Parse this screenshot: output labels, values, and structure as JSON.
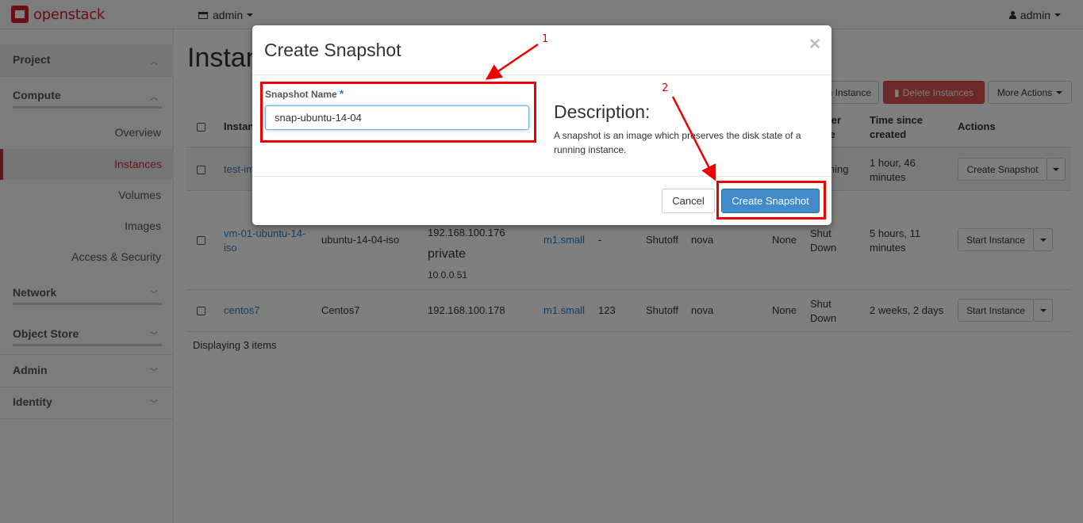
{
  "topbar": {
    "brand": "openstack",
    "project": "admin",
    "user": "admin"
  },
  "sidebar": {
    "project": "Project",
    "compute": "Compute",
    "items": [
      "Overview",
      "Instances",
      "Volumes",
      "Images",
      "Access & Security"
    ],
    "network": "Network",
    "object_store": "Object Store",
    "admin": "Admin",
    "identity": "Identity"
  },
  "page": {
    "title": "Instances",
    "buttons": {
      "launch": "Launch Instance",
      "delete": "Delete Instances",
      "more": "More Actions"
    }
  },
  "table": {
    "headers": {
      "name": "Instance Name",
      "power": "Power State",
      "time": "Time since created",
      "actions": "Actions"
    },
    "rows": [
      {
        "name": "test-im",
        "power": "Running",
        "time": "1 hour, 46 minutes",
        "action": "Create Snapshot"
      },
      {
        "name": "vm-01-ubuntu-14-iso",
        "image": "ubuntu-14-04-iso",
        "ip1": "192.168.100.176",
        "net": "private",
        "ip2": "10.0.0.51",
        "size": "m1.small",
        "key": "-",
        "status": "Shutoff",
        "zone": "nova",
        "task": "None",
        "power": "Shut Down",
        "time": "5 hours, 11 minutes",
        "action": "Start Instance"
      },
      {
        "name": "centos7",
        "image": "Centos7",
        "ip1": "192.168.100.178",
        "size": "m1.small",
        "key": "123",
        "status": "Shutoff",
        "zone": "nova",
        "task": "None",
        "power": "Shut Down",
        "time": "2 weeks, 2 days",
        "action": "Start Instance"
      }
    ],
    "footer": "Displaying 3 items"
  },
  "modal": {
    "title": "Create Snapshot",
    "close": "×",
    "field_label": "Snapshot Name",
    "required_mark": "*",
    "field_value": "snap-ubuntu-14-04",
    "desc_title": "Description:",
    "desc_text": "A snapshot is an image which preserves the disk state of a running instance.",
    "cancel": "Cancel",
    "submit": "Create Snapshot"
  },
  "annotations": {
    "step1": "1",
    "step2": "2",
    "color": "#e00000"
  }
}
